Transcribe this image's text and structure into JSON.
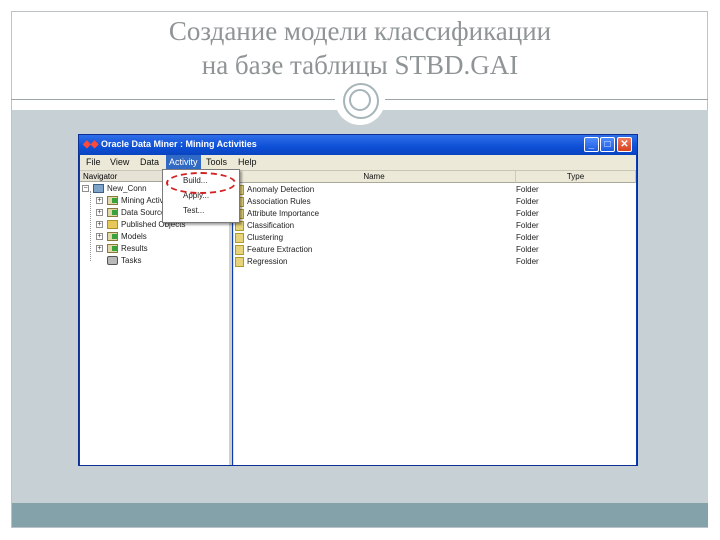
{
  "slide": {
    "title_line1": "Создание модели классификации",
    "title_line2": "на базе таблицы STBD.GAI"
  },
  "window": {
    "title": "Oracle Data Miner : Mining Activities",
    "menu": [
      {
        "label": "File",
        "active": false
      },
      {
        "label": "View",
        "active": false
      },
      {
        "label": "Data",
        "active": false
      },
      {
        "label": "Activity",
        "active": true
      },
      {
        "label": "Tools",
        "active": false
      },
      {
        "label": "Help",
        "active": false
      }
    ],
    "buttons": {
      "minimize": "_",
      "maximize": "□",
      "close": "✕"
    }
  },
  "navigator": {
    "header": "Navigator",
    "items": [
      {
        "label": "New_Conn",
        "icon": "connection-icon"
      },
      {
        "label": "Mining Activities",
        "icon": "mining-activities-icon"
      },
      {
        "label": "Data Sources",
        "icon": "data-sources-icon"
      },
      {
        "label": "Published Objects",
        "icon": "published-objects-icon"
      },
      {
        "label": "Models",
        "icon": "models-icon"
      },
      {
        "label": "Results",
        "icon": "results-icon"
      },
      {
        "label": "Tasks",
        "icon": "tasks-icon"
      }
    ]
  },
  "activity_menu": {
    "items": [
      "Build...",
      "Apply...",
      "Test..."
    ]
  },
  "list": {
    "headers": {
      "name": "Name",
      "type": "Type"
    },
    "rows": [
      {
        "name": "Anomaly Detection",
        "type": "Folder"
      },
      {
        "name": "Association Rules",
        "type": "Folder"
      },
      {
        "name": "Attribute Importance",
        "type": "Folder"
      },
      {
        "name": "Classification",
        "type": "Folder"
      },
      {
        "name": "Clustering",
        "type": "Folder"
      },
      {
        "name": "Feature Extraction",
        "type": "Folder"
      },
      {
        "name": "Regression",
        "type": "Folder"
      }
    ]
  }
}
